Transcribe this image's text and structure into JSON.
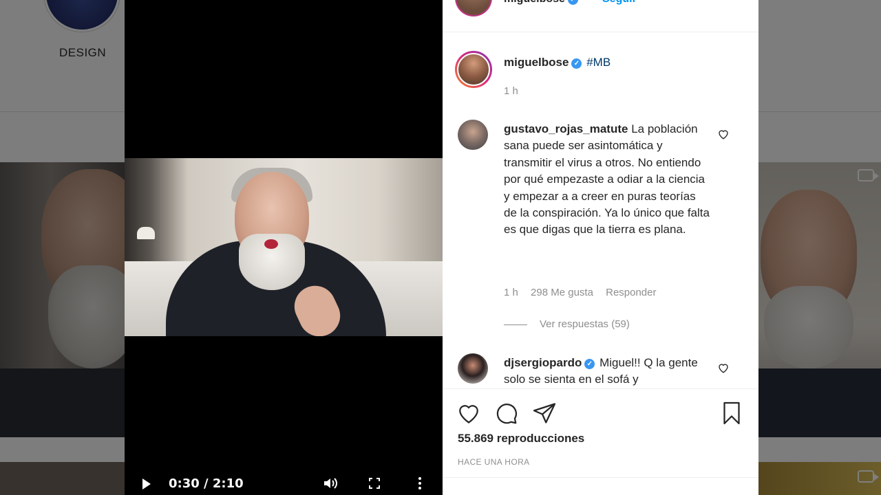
{
  "background": {
    "highlight_label": "DESIGN"
  },
  "video": {
    "current_time": "0:30",
    "duration": "2:10",
    "time_display": "0:30 / 2:10"
  },
  "post": {
    "header": {
      "username": "miguelbose",
      "follow_label": "Seguir",
      "more_label": "···"
    },
    "caption": {
      "username": "miguelbose",
      "text": "#MB",
      "time": "1 h"
    },
    "comments": [
      {
        "username": "gustavo_rojas_matute",
        "text": "La población sana puede ser asintomática y transmitir el virus a otros. No entiendo por qué empezaste a odiar a la ciencia y empezar a a creer en puras teorías de la conspiración. Ya lo único que falta es que digas que la tierra es plana.",
        "time": "1 h",
        "likes": "298 Me gusta",
        "reply_label": "Responder",
        "view_replies": "Ver respuestas (59)"
      },
      {
        "username": "djsergiopardo",
        "verified": true,
        "text": "Miguel!! Q la gente solo se sienta en el sofá y"
      }
    ],
    "views": "55.869 reproducciones",
    "posted": "HACE UNA HORA"
  },
  "icons": {
    "header_more": "more-icon",
    "verified": "verified-badge-icon",
    "like": "heart-icon",
    "comment": "comment-icon",
    "share": "share-icon",
    "save": "bookmark-icon",
    "play": "play-icon",
    "volume": "volume-icon",
    "fullscreen": "fullscreen-icon",
    "video_more": "vertical-dots-icon"
  },
  "colors": {
    "link_blue": "#0095f6",
    "verified_blue": "#3897f0",
    "hashtag": "#00376b",
    "muted_text": "#8e8e8e",
    "text": "#262626"
  }
}
